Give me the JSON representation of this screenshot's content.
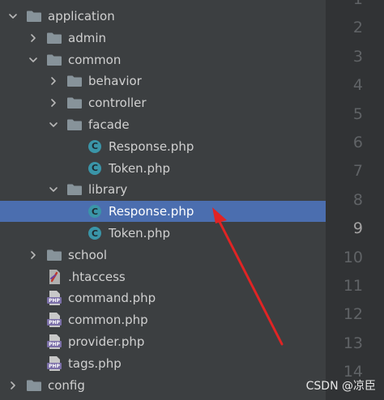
{
  "top_fragment": "ʼ  ̀ ̄  ʼ̀ '  ̅  ̄ ̀",
  "tree": [
    {
      "label": "application",
      "kind": "folder",
      "depth": 0,
      "arrow": "down",
      "key": "application"
    },
    {
      "label": "admin",
      "kind": "folder",
      "depth": 1,
      "arrow": "right",
      "key": "admin"
    },
    {
      "label": "common",
      "kind": "folder",
      "depth": 1,
      "arrow": "down",
      "key": "common"
    },
    {
      "label": "behavior",
      "kind": "folder",
      "depth": 2,
      "arrow": "right",
      "key": "behavior"
    },
    {
      "label": "controller",
      "kind": "folder",
      "depth": 2,
      "arrow": "right",
      "key": "controller"
    },
    {
      "label": "facade",
      "kind": "folder",
      "depth": 2,
      "arrow": "down",
      "key": "facade"
    },
    {
      "label": "Response.php",
      "kind": "class",
      "depth": 3,
      "arrow": "none",
      "key": "facade-response"
    },
    {
      "label": "Token.php",
      "kind": "class",
      "depth": 3,
      "arrow": "none",
      "key": "facade-token"
    },
    {
      "label": "library",
      "kind": "folder",
      "depth": 2,
      "arrow": "down",
      "key": "library"
    },
    {
      "label": "Response.php",
      "kind": "class",
      "depth": 3,
      "arrow": "none",
      "key": "library-response",
      "selected": true
    },
    {
      "label": "Token.php",
      "kind": "class",
      "depth": 3,
      "arrow": "none",
      "key": "library-token"
    },
    {
      "label": "school",
      "kind": "folder",
      "depth": 1,
      "arrow": "right",
      "key": "school"
    },
    {
      "label": ".htaccess",
      "kind": "htaccess",
      "depth": 1,
      "arrow": "none",
      "key": "htaccess"
    },
    {
      "label": "command.php",
      "kind": "php",
      "depth": 1,
      "arrow": "none",
      "key": "command"
    },
    {
      "label": "common.php",
      "kind": "php",
      "depth": 1,
      "arrow": "none",
      "key": "common-php"
    },
    {
      "label": "provider.php",
      "kind": "php",
      "depth": 1,
      "arrow": "none",
      "key": "provider"
    },
    {
      "label": "tags.php",
      "kind": "php",
      "depth": 1,
      "arrow": "none",
      "key": "tags"
    },
    {
      "label": "config",
      "kind": "folder",
      "depth": 0,
      "arrow": "right",
      "key": "config"
    }
  ],
  "icon_text": {
    "class_letter": "C",
    "php_badge": "PHP"
  },
  "gutter": {
    "line_numbers": [
      "1",
      "2",
      "3",
      "4",
      "5",
      "6",
      "7",
      "8",
      "9",
      "10",
      "11",
      "12",
      "13",
      "14"
    ],
    "current_line": "9"
  },
  "watermark": "CSDN @凉臣",
  "colors": {
    "background": "#3c3f41",
    "gutter": "#313335",
    "selection": "#4b6eaf",
    "folder": "#87939a",
    "class_icon": "#3a95a8",
    "php_icon": "#7b6fa8",
    "annotation_arrow": "#e02424"
  },
  "icons": {
    "folder": "folder-icon",
    "class": "php-class-icon",
    "php": "php-file-icon",
    "htaccess": "htaccess-file-icon",
    "expanded": "chevron-down-icon",
    "collapsed": "chevron-right-icon"
  }
}
